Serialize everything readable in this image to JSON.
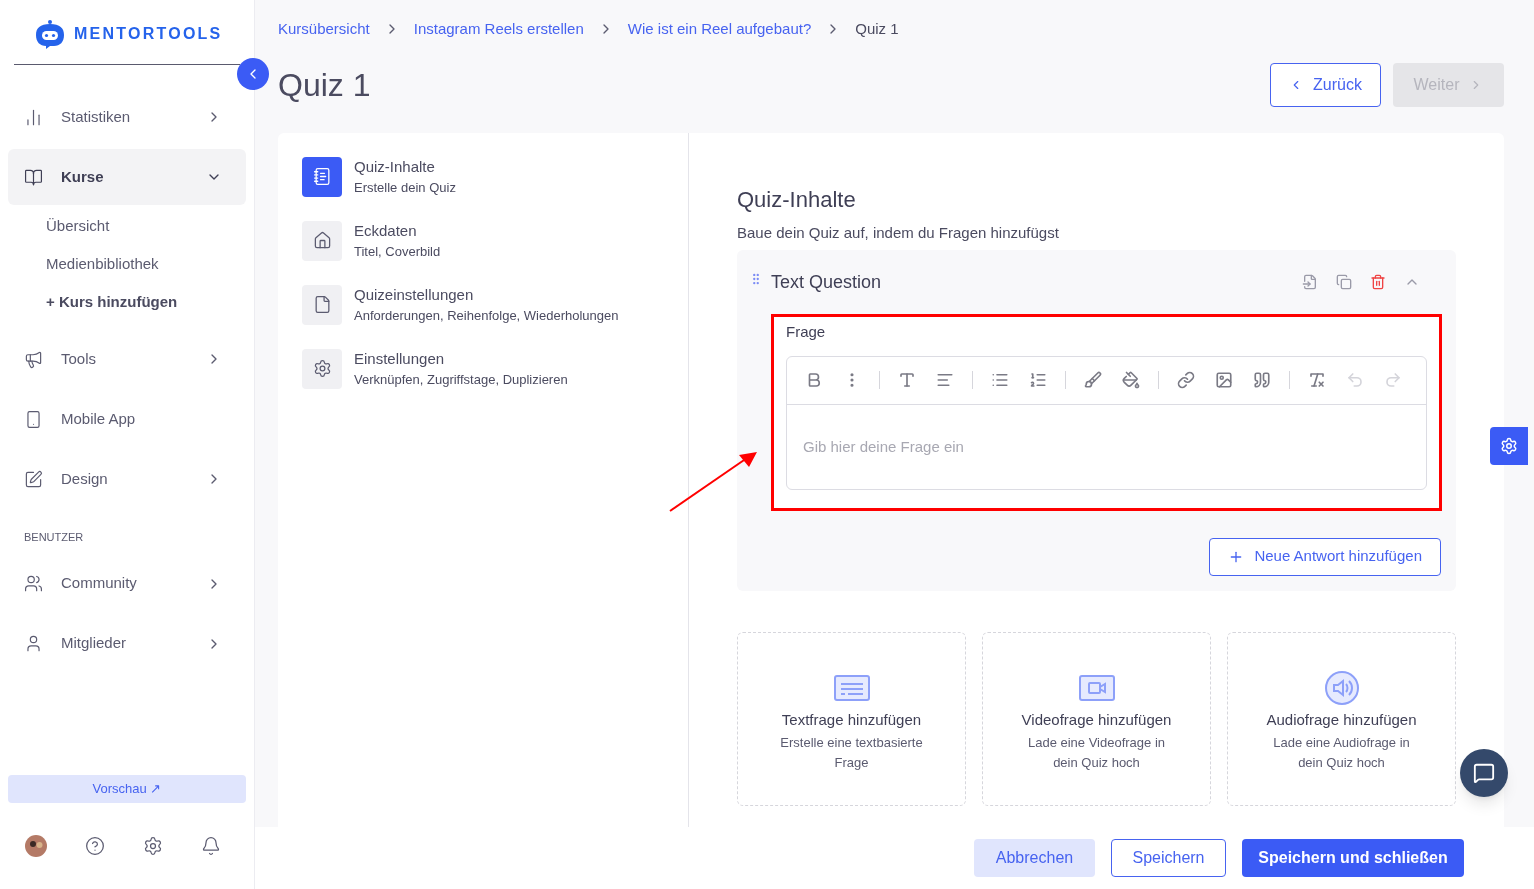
{
  "brand": {
    "name": "MENTORTOOLS"
  },
  "sidebar": {
    "items": [
      {
        "label": "Statistiken",
        "kind": "nav",
        "has_submenu": true,
        "expanded": false
      },
      {
        "label": "Kurse",
        "kind": "nav",
        "has_submenu": true,
        "expanded": true,
        "children": [
          {
            "label": "Übersicht",
            "bold": false
          },
          {
            "label": "Medienbibliothek",
            "bold": false
          },
          {
            "label": "+ Kurs hinzufügen",
            "bold": true
          }
        ]
      },
      {
        "label": "Tools",
        "kind": "nav",
        "has_submenu": true,
        "expanded": false
      },
      {
        "label": "Mobile App",
        "kind": "nav",
        "has_submenu": false,
        "expanded": false
      },
      {
        "label": "Design",
        "kind": "nav",
        "has_submenu": true,
        "expanded": false
      },
      {
        "label": "BENUTZER",
        "kind": "section"
      },
      {
        "label": "Community",
        "kind": "nav",
        "has_submenu": true,
        "expanded": false
      },
      {
        "label": "Mitglieder",
        "kind": "nav",
        "has_submenu": true,
        "expanded": false
      }
    ],
    "preview_button": "Vorschau ↗"
  },
  "breadcrumbs": [
    {
      "label": "Kursübersicht",
      "current": false
    },
    {
      "label": "Instagram Reels erstellen",
      "current": false
    },
    {
      "label": "Wie ist ein Reel aufgebaut?",
      "current": false
    },
    {
      "label": "Quiz 1",
      "current": true
    }
  ],
  "page_title": "Quiz 1",
  "nav_buttons": [
    {
      "label": "Zurück",
      "disabled": false
    },
    {
      "label": "Weiter",
      "disabled": true
    }
  ],
  "steps": [
    {
      "title": "Quiz-Inhalte",
      "subtitle": "Erstelle dein Quiz",
      "selected": true
    },
    {
      "title": "Eckdaten",
      "subtitle": "Titel, Coverbild",
      "selected": false
    },
    {
      "title": "Quizeinstellungen",
      "subtitle": "Anforderungen, Reihenfolge, Wiederholungen",
      "selected": false
    },
    {
      "title": "Einstellungen",
      "subtitle": "Verknüpfen, Zugriffstage, Duplizieren",
      "selected": false
    }
  ],
  "content": {
    "heading": "Quiz-Inhalte",
    "description": "Baue dein Quiz auf, indem du Fragen hinzufügst",
    "question": {
      "title": "Text Question",
      "expanded": true,
      "field_label": "Frage",
      "placeholder": "Gib hier deine Frage ein",
      "toolbar": [
        [
          {
            "disabled": false
          },
          {
            "disabled": false
          }
        ],
        [
          {
            "disabled": false
          },
          {
            "disabled": false
          }
        ],
        [
          {
            "disabled": false
          },
          {
            "disabled": false
          }
        ],
        [
          {
            "disabled": false
          },
          {
            "disabled": false
          }
        ],
        [
          {
            "disabled": false
          },
          {
            "disabled": false
          },
          {
            "disabled": false
          }
        ],
        [
          {
            "disabled": false
          },
          {
            "disabled": true
          },
          {
            "disabled": true
          }
        ]
      ],
      "add_answer": "Neue Antwort hinzufügen"
    },
    "add_cards": [
      {
        "kind": "text",
        "title": "Textfrage hinzufügen",
        "description": "Erstelle eine textbasierte Frage"
      },
      {
        "kind": "video",
        "title": "Videofrage hinzufügen",
        "description": "Lade eine Videofrage in dein Quiz hoch"
      },
      {
        "kind": "audio",
        "title": "Audiofrage hinzufügen",
        "description": "Lade eine Audiofrage in dein Quiz hoch"
      }
    ]
  },
  "footer": {
    "buttons": [
      {
        "label": "Abbrechen",
        "kind": "soft"
      },
      {
        "label": "Speichern",
        "kind": "outline"
      },
      {
        "label": "Speichern und schließen",
        "kind": "primary"
      }
    ]
  }
}
